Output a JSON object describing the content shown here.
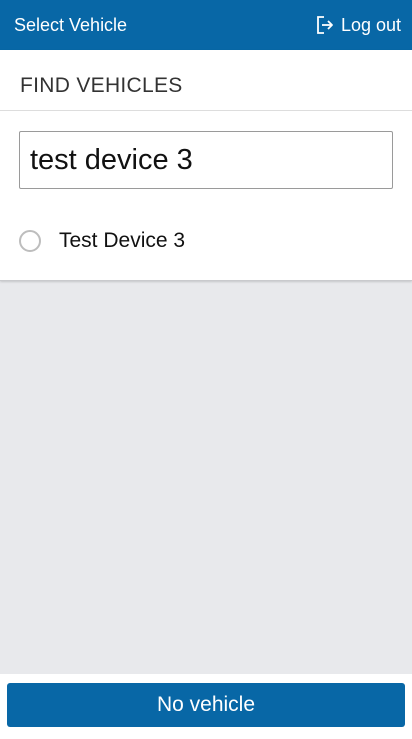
{
  "header": {
    "title": "Select Vehicle",
    "logout_label": "Log out",
    "logout_icon": "logout-icon",
    "background_color": "#0867a6"
  },
  "search_panel": {
    "section_title": "FIND VEHICLES",
    "search_value": "test device 3",
    "results": [
      {
        "label": "Test Device 3",
        "selected": false
      }
    ]
  },
  "footer": {
    "primary_button_label": "No vehicle",
    "button_color": "#0867a6"
  }
}
